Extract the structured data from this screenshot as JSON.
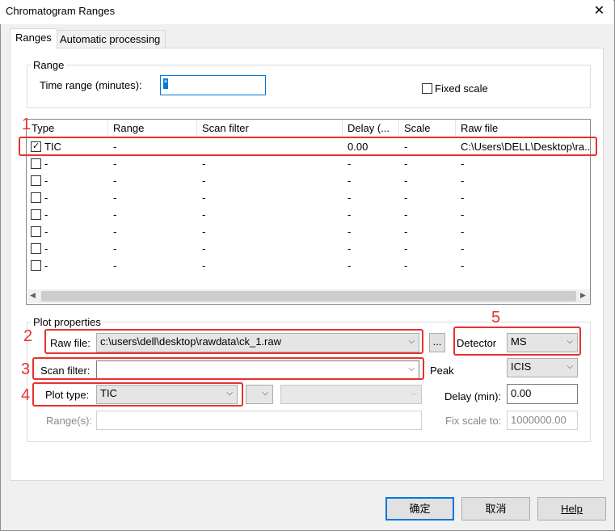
{
  "window": {
    "title": "Chromatogram Ranges",
    "close_glyph": "✕"
  },
  "tabs": [
    {
      "label": "Ranges",
      "active": true
    },
    {
      "label": "Automatic processing",
      "active": false
    }
  ],
  "range_group": {
    "legend": "Range",
    "time_range_label": "Time range (minutes):",
    "time_range_value": "*",
    "fixed_scale_label": "Fixed scale",
    "fixed_scale_checked": false
  },
  "table": {
    "columns": [
      "Type",
      "Range",
      "Scan filter",
      "Delay (...",
      "Scale",
      "Raw file"
    ],
    "rows": [
      {
        "checked": true,
        "type": "TIC",
        "range": "-",
        "scan_filter": "",
        "delay": "0.00",
        "scale": "-",
        "raw_file": "C:\\Users\\DELL\\Desktop\\ra..."
      },
      {
        "checked": false,
        "type": "-",
        "range": "-",
        "scan_filter": "-",
        "delay": "-",
        "scale": "-",
        "raw_file": "-"
      },
      {
        "checked": false,
        "type": "-",
        "range": "-",
        "scan_filter": "-",
        "delay": "-",
        "scale": "-",
        "raw_file": "-"
      },
      {
        "checked": false,
        "type": "-",
        "range": "-",
        "scan_filter": "-",
        "delay": "-",
        "scale": "-",
        "raw_file": "-"
      },
      {
        "checked": false,
        "type": "-",
        "range": "-",
        "scan_filter": "-",
        "delay": "-",
        "scale": "-",
        "raw_file": "-"
      },
      {
        "checked": false,
        "type": "-",
        "range": "-",
        "scan_filter": "-",
        "delay": "-",
        "scale": "-",
        "raw_file": "-"
      },
      {
        "checked": false,
        "type": "-",
        "range": "-",
        "scan_filter": "-",
        "delay": "-",
        "scale": "-",
        "raw_file": "-"
      },
      {
        "checked": false,
        "type": "-",
        "range": "-",
        "scan_filter": "-",
        "delay": "-",
        "scale": "-",
        "raw_file": "-"
      }
    ]
  },
  "plot_properties": {
    "legend": "Plot properties",
    "raw_file_label": "Raw file:",
    "raw_file_value": "c:\\users\\dell\\desktop\\rawdata\\ck_1.raw",
    "browse_label": "...",
    "detector_label": "Detector",
    "detector_value": "MS",
    "scan_filter_label": "Scan filter:",
    "scan_filter_value": "",
    "peak_label": "Peak",
    "peak_value": "ICIS",
    "plot_type_label": "Plot type:",
    "plot_type_value": "TIC",
    "delay_label": "Delay (min):",
    "delay_value": "0.00",
    "ranges_label": "Range(s):",
    "ranges_value": "",
    "fix_scale_label": "Fix scale to:",
    "fix_scale_value": "1000000.00"
  },
  "annotations": [
    "1",
    "2",
    "3",
    "4",
    "5"
  ],
  "buttons": {
    "ok": "确定",
    "cancel": "取消",
    "help": "Help"
  },
  "colors": {
    "annotation_red": "#e8322f",
    "focus_blue": "#0078d7"
  }
}
